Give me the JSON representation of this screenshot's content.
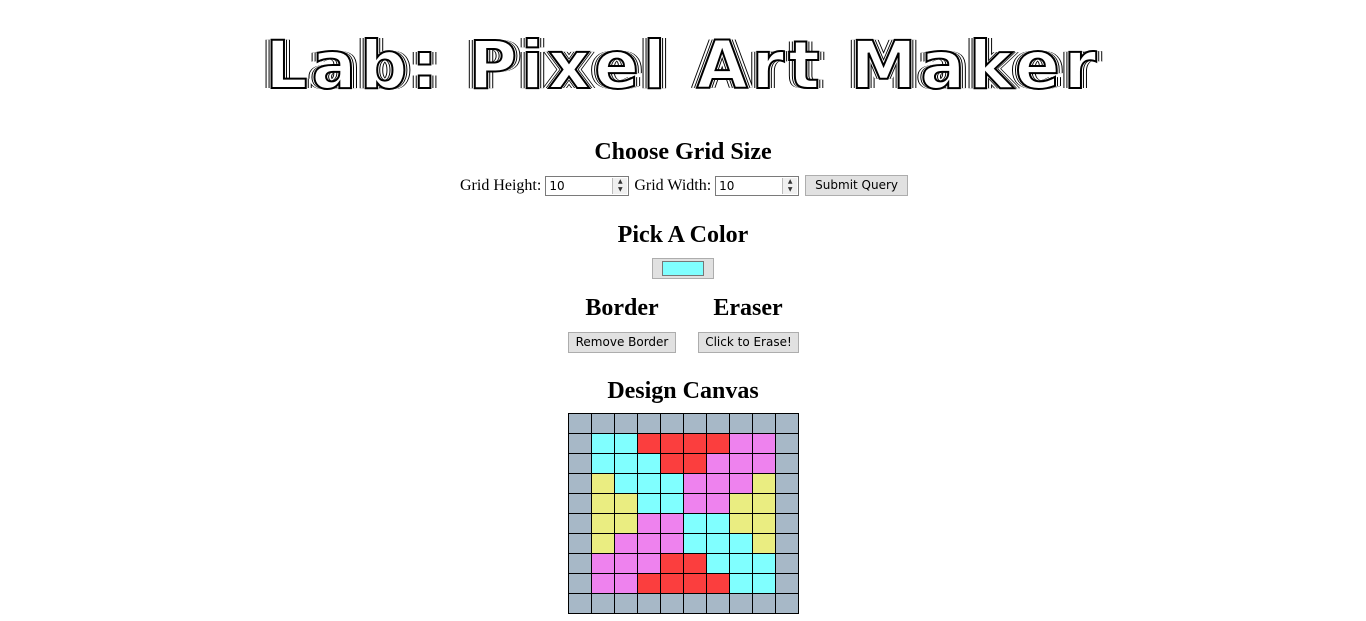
{
  "title": "Lab: Pixel Art Maker",
  "grid_form": {
    "heading": "Choose Grid Size",
    "height_label": "Grid Height:",
    "height_value": "10",
    "width_label": "Grid Width:",
    "width_value": "10",
    "submit_label": "Submit Query"
  },
  "color": {
    "heading": "Pick A Color",
    "value": "#80ffff"
  },
  "border": {
    "heading": "Border",
    "button_label": "Remove Border"
  },
  "eraser": {
    "heading": "Eraser",
    "button_label": "Click to Erase!"
  },
  "canvas": {
    "heading": "Design Canvas",
    "palette": {
      "g": "#a7b8c7",
      "c": "#80ffff",
      "r": "#fb3e3e",
      "p": "#ee82ee",
      "y": "#eaed81"
    },
    "rows": [
      [
        "g",
        "g",
        "g",
        "g",
        "g",
        "g",
        "g",
        "g",
        "g",
        "g"
      ],
      [
        "g",
        "c",
        "c",
        "r",
        "r",
        "r",
        "r",
        "p",
        "p",
        "g"
      ],
      [
        "g",
        "c",
        "c",
        "c",
        "r",
        "r",
        "p",
        "p",
        "p",
        "g"
      ],
      [
        "g",
        "y",
        "c",
        "c",
        "c",
        "p",
        "p",
        "p",
        "y",
        "g"
      ],
      [
        "g",
        "y",
        "y",
        "c",
        "c",
        "p",
        "p",
        "y",
        "y",
        "g"
      ],
      [
        "g",
        "y",
        "y",
        "p",
        "p",
        "c",
        "c",
        "y",
        "y",
        "g"
      ],
      [
        "g",
        "y",
        "p",
        "p",
        "p",
        "c",
        "c",
        "c",
        "y",
        "g"
      ],
      [
        "g",
        "p",
        "p",
        "p",
        "r",
        "r",
        "c",
        "c",
        "c",
        "g"
      ],
      [
        "g",
        "p",
        "p",
        "r",
        "r",
        "r",
        "r",
        "c",
        "c",
        "g"
      ],
      [
        "g",
        "g",
        "g",
        "g",
        "g",
        "g",
        "g",
        "g",
        "g",
        "g"
      ]
    ]
  }
}
